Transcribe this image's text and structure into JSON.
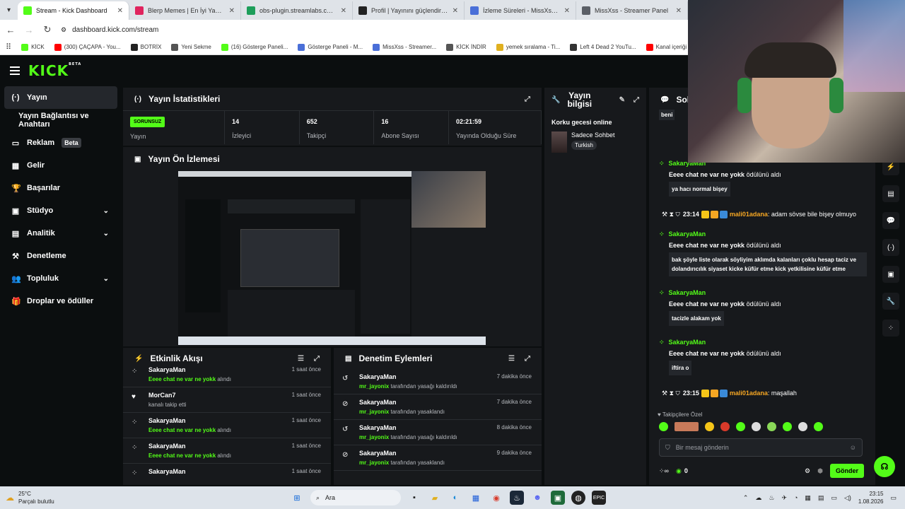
{
  "browser": {
    "tabs": [
      {
        "title": "Stream - Kick Dashboard",
        "color": "#53fc18",
        "active": true
      },
      {
        "title": "Blerp Memes | En İyi Yayıncı Deste",
        "color": "#e0245e",
        "active": false
      },
      {
        "title": "obs-plugin.streamlabs.com/auth...",
        "color": "#1d9e5a",
        "active": false
      },
      {
        "title": "Profil | Yayınını güçlendirmek için",
        "color": "#222222",
        "active": false
      },
      {
        "title": "İzleme Süreleri - MissXss AI Bot",
        "color": "#4a6fd8",
        "active": false
      },
      {
        "title": "MissXss - Streamer Panel",
        "color": "#5b5f66",
        "active": false
      }
    ],
    "url": "dashboard.kick.com/stream",
    "bookmarks": [
      {
        "label": "KİCK",
        "color": "#53fc18"
      },
      {
        "label": "(300) ÇAÇAPA - You...",
        "color": "#ff0000"
      },
      {
        "label": "BOTRİX",
        "color": "#222222"
      },
      {
        "label": "Yeni Sekme",
        "color": "#555555"
      },
      {
        "label": "(16) Gösterge Paneli...",
        "color": "#53fc18"
      },
      {
        "label": "Gösterge Paneli - M...",
        "color": "#4a6fd8"
      },
      {
        "label": "MissXss - Streamer...",
        "color": "#4a6fd8"
      },
      {
        "label": "KİCK İNDİR",
        "color": "#555555"
      },
      {
        "label": "yemek sıralama - Ti...",
        "color": "#e0b020"
      },
      {
        "label": "Left 4 Dead 2 YouTu...",
        "color": "#333333"
      },
      {
        "label": "Kanal içeriği - YouT...",
        "color": "#ff0000"
      }
    ]
  },
  "kick": {
    "logo": "KICK",
    "logo_sup": "BETA",
    "sidebar": [
      {
        "label": "Yayın",
        "icon": "(·)",
        "active": true,
        "chev": false
      },
      {
        "label": "Yayın Bağlantısı ve Anahtarı",
        "icon": "",
        "active": false,
        "chev": false
      },
      {
        "label": "Reklam",
        "icon": "▭",
        "active": false,
        "chev": false,
        "badge": "Beta"
      },
      {
        "label": "Gelir",
        "icon": "▦",
        "active": false,
        "chev": false
      },
      {
        "label": "Başarılar",
        "icon": "🏆",
        "active": false,
        "chev": false
      },
      {
        "label": "Stüdyo",
        "icon": "▣",
        "active": false,
        "chev": true
      },
      {
        "label": "Analitik",
        "icon": "▤",
        "active": false,
        "chev": true
      },
      {
        "label": "Denetleme",
        "icon": "⚒",
        "active": false,
        "chev": false
      },
      {
        "label": "Topluluk",
        "icon": "👥",
        "active": false,
        "chev": true
      },
      {
        "label": "Droplar ve ödüller",
        "icon": "🎁",
        "active": false,
        "chev": false
      }
    ],
    "stats_panel": {
      "title": "Yayın İstatistikleri",
      "status_badge": "SORUNSUZ",
      "status_label": "Yayın",
      "items": [
        {
          "value": "14",
          "label": "İzleyici"
        },
        {
          "value": "652",
          "label": "Takipçi"
        },
        {
          "value": "16",
          "label": "Abone Sayısı"
        },
        {
          "value": "02:21:59",
          "label": "Yayında Olduğu Süre"
        }
      ]
    },
    "info_panel": {
      "title_line1": "Yayın",
      "title_line2": "bilgisi",
      "stream_title": "Korku gecesi online",
      "category": "Sadece Sohbet",
      "tag": "Turkish"
    },
    "preview_panel": {
      "title": "Yayın Ön İzlemesi"
    },
    "activity_panel": {
      "title": "Etkinlik Akışı",
      "items": [
        {
          "name": "SakaryaMan",
          "reward": "Eeee chat ne var ne yokk",
          "suffix": "alındı",
          "time": "1 saat önce",
          "icon": "⁘"
        },
        {
          "name": "MorCan7",
          "reward": "",
          "suffix": "kanalı takip etti",
          "time": "1 saat önce",
          "icon": "♥"
        },
        {
          "name": "SakaryaMan",
          "reward": "Eeee chat ne var ne yokk",
          "suffix": "alındı",
          "time": "1 saat önce",
          "icon": "⁘"
        },
        {
          "name": "SakaryaMan",
          "reward": "Eeee chat ne var ne yokk",
          "suffix": "alındı",
          "time": "1 saat önce",
          "icon": "⁘"
        },
        {
          "name": "SakaryaMan",
          "reward": "",
          "suffix": "",
          "time": "1 saat önce",
          "icon": "⁘"
        }
      ]
    },
    "moderation_panel": {
      "title": "Denetim Eylemleri",
      "items": [
        {
          "name": "SakaryaMan",
          "mod": "mr_jayonix",
          "action": "tarafından yasağı kaldırıldı",
          "time": "7 dakika önce",
          "icon": "↺"
        },
        {
          "name": "SakaryaMan",
          "mod": "mr_jayonix",
          "action": "tarafından yasaklandı",
          "time": "7 dakika önce",
          "icon": "⊘"
        },
        {
          "name": "SakaryaMan",
          "mod": "mr_jayonix",
          "action": "tarafından yasağı kaldırıldı",
          "time": "8 dakika önce",
          "icon": "↺"
        },
        {
          "name": "SakaryaMan",
          "mod": "mr_jayonix",
          "action": "tarafından yasaklandı",
          "time": "9 dakika önce",
          "icon": "⊘"
        }
      ]
    },
    "chat": {
      "title": "Sohbet",
      "top_bubble": "beni",
      "messages": [
        {
          "type": "reward",
          "who": "SakaryaMan",
          "reward": "Eeee chat ne var ne yokk",
          "reward_suffix": "ödülünü aldı",
          "text": "ya hacı normal bişey"
        },
        {
          "type": "line",
          "time": "23:14",
          "user": "mali01adana",
          "text": ": adam sövse bile bişey olmuyo"
        },
        {
          "type": "reward",
          "who": "SakaryaMan",
          "reward": "Eeee chat ne var ne yokk",
          "reward_suffix": "ödülünü aldı",
          "text": "bak şöyle liste olarak söyliyim aklımda kalanları çoklu hesap taciz ve dolandırıcılık siyaset kicke küfür etme kick yetkilisine küfür etme"
        },
        {
          "type": "reward",
          "who": "SakaryaMan",
          "reward": "Eeee chat ne var ne yokk",
          "reward_suffix": "ödülünü aldı",
          "text": "tacizle alakam yok"
        },
        {
          "type": "reward",
          "who": "SakaryaMan",
          "reward": "Eeee chat ne var ne yokk",
          "reward_suffix": "ödülünü aldı",
          "text": "iftira o"
        },
        {
          "type": "line",
          "time": "23:15",
          "user": "mali01adana",
          "text": ": maşallah"
        }
      ],
      "emote_label": "♥ Takipçilere Özel",
      "input_placeholder": "Bir mesaj gönderin",
      "points": "0",
      "send_label": "Gönder"
    }
  },
  "taskbar": {
    "weather_temp": "25°C",
    "weather_desc": "Parçalı bulutlu",
    "search_label": "Ara",
    "time": "23:15",
    "date": "1.08.2026"
  }
}
